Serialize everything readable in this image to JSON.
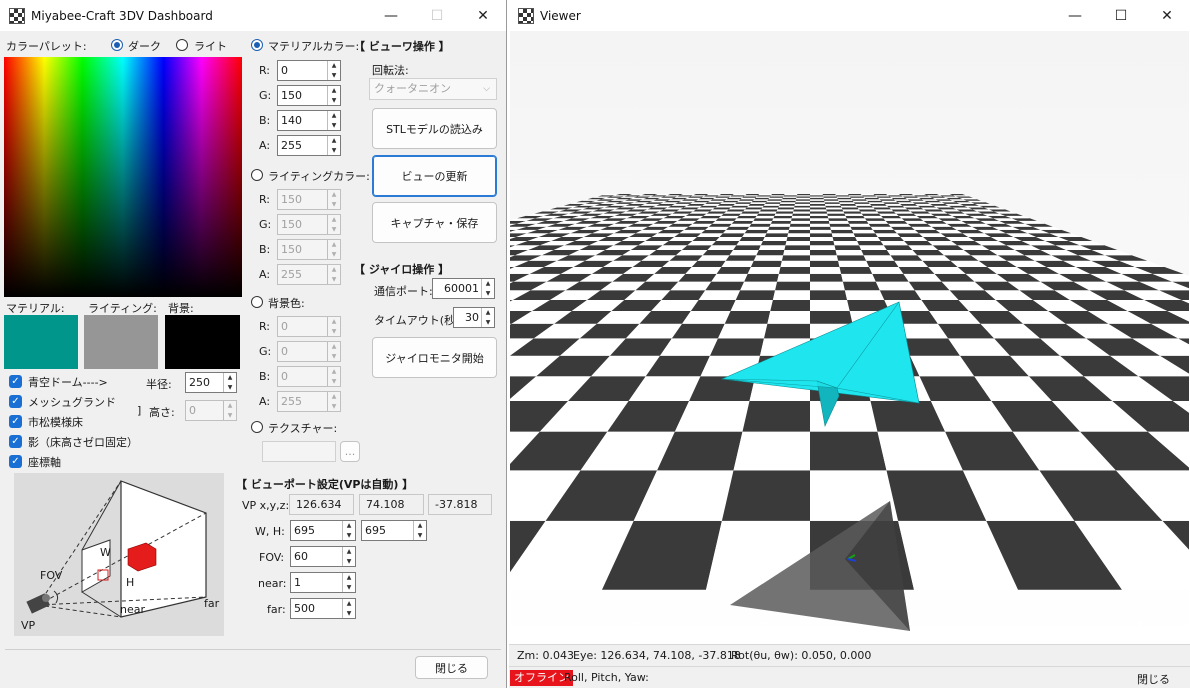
{
  "dashboard": {
    "title": "Miyabee-Craft 3DV Dashboard",
    "palette_label": "カラーパレット:",
    "theme_dark": "ダーク",
    "theme_light": "ライト",
    "swatch_material": "マテリアル:",
    "swatch_lighting": "ライティング:",
    "swatch_bg": "背景:",
    "swatch_colors": {
      "material": "#00968c",
      "lighting": "#969696",
      "background": "#000000"
    },
    "checks": [
      {
        "label": "青空ドーム---->",
        "checked": true
      },
      {
        "label": "メッシュグランド",
        "checked": true
      },
      {
        "label": "市松模様床",
        "checked": true
      },
      {
        "label": "影（床高さゼロ固定）",
        "checked": true
      },
      {
        "label": "座標軸",
        "checked": true
      }
    ],
    "radius_label": "半径:",
    "radius_value": "250",
    "height_label": "高さ:",
    "height_bracket": "]",
    "height_value": "0",
    "material_color": {
      "label": "マテリアルカラー:",
      "r_label": "R:",
      "r": "0",
      "g_label": "G:",
      "g": "150",
      "b_label": "B:",
      "b": "140",
      "a_label": "A:",
      "a": "255"
    },
    "lighting_color": {
      "label": "ライティングカラー:",
      "r_label": "R:",
      "r": "150",
      "g_label": "G:",
      "g": "150",
      "b_label": "B:",
      "b": "150",
      "a_label": "A:",
      "a": "255"
    },
    "bg_color": {
      "label": "背景色:",
      "r_label": "R:",
      "r": "0",
      "g_label": "G:",
      "g": "0",
      "b_label": "B:",
      "b": "0",
      "a_label": "A:",
      "a": "255"
    },
    "texture_label": "テクスチャー:",
    "texture_browse": "...",
    "view_ops": {
      "header": "【 ビューワ操作 】",
      "rotation_label": "回転法:",
      "rotation_value": "クォータニオン",
      "load_stl": "STLモデルの読込み",
      "update_view": "ビューの更新",
      "capture": "キャプチャ・保存"
    },
    "gyro": {
      "header": "【 ジャイロ操作 】",
      "port_label": "通信ポート:",
      "port_value": "60001",
      "timeout_label": "タイムアウト(秒):",
      "timeout_value": "30",
      "start": "ジャイロモニタ開始"
    },
    "viewport": {
      "header": "【 ビューポート設定(VPは自動) 】",
      "vp_label": "VP x,y,z:",
      "vp_x": "126.634",
      "vp_y": "74.108",
      "vp_z": "-37.818",
      "wh_label": "W, H:",
      "w": "695",
      "h": "695",
      "fov_label": "FOV:",
      "fov": "60",
      "near_label": "near:",
      "near": "1",
      "far_label": "far:",
      "far": "500"
    },
    "diagram": {
      "fov": "FOV",
      "w": "W",
      "h": "H",
      "near": "near",
      "far": "far",
      "vp": "VP"
    },
    "close": "閉じる"
  },
  "viewer": {
    "title": "Viewer",
    "status_zm": "Zm: 0.043",
    "status_eye": "Eye: 126.634, 74.108, -37.818",
    "status_rot": "Rot(θu, θw): 0.050, 0.000",
    "offline": "オフライン",
    "rpy": "Roll, Pitch, Yaw:",
    "close": "閉じる",
    "model_color": "#1fe6ee"
  }
}
